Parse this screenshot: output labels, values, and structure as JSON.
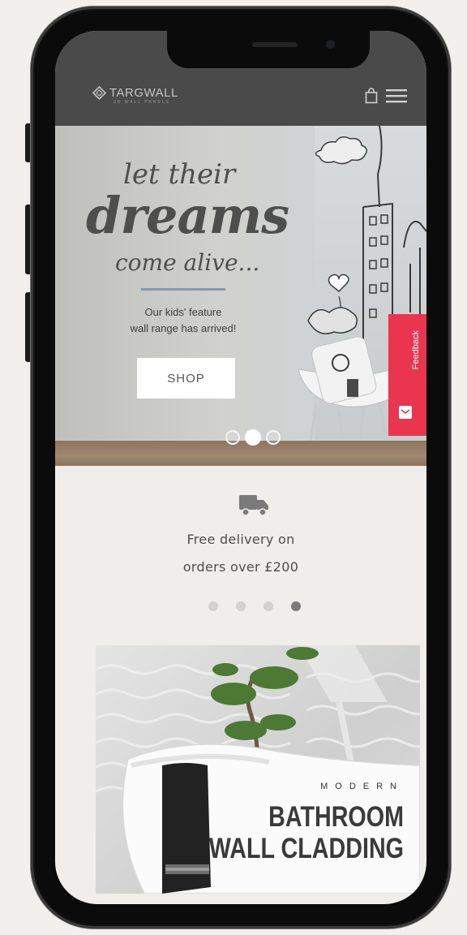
{
  "header": {
    "brand": "TARGWALL",
    "brand_sub": "3D WALL PANELS",
    "icons": [
      "shopping-bag-icon",
      "hamburger-menu-icon"
    ]
  },
  "hero": {
    "line1": "let their",
    "line2": "dreams",
    "line3": "come alive...",
    "tagline_1": "Our kids' feature",
    "tagline_2": "wall range has arrived!",
    "button_label": "SHOP",
    "carousel": {
      "total": 3,
      "active": 2
    },
    "accent_color": "#7f9bb6"
  },
  "feedback": {
    "label": "Feedback",
    "color": "#e9364e"
  },
  "delivery": {
    "line1": "Free delivery on",
    "line2": "orders over £200",
    "icon": "delivery-truck-icon",
    "carousel": {
      "total": 4,
      "active": 4
    }
  },
  "promo": {
    "kicker": "MODERN",
    "title_1": "BATHROOM",
    "title_2": "WALL CLADDING"
  },
  "colors": {
    "header_bg": "#4b4a4a",
    "page_bg": "#efeeea",
    "phone_frame": "#0b0b0b"
  }
}
